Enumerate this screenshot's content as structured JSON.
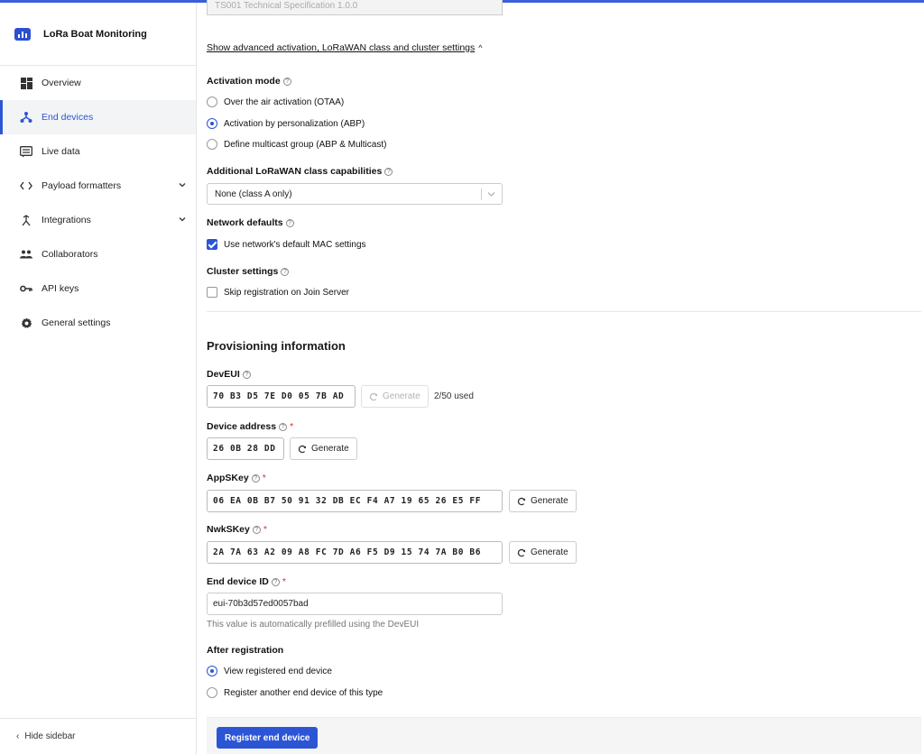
{
  "app": {
    "title": "LoRa Boat Monitoring",
    "accent": "#2c55d6"
  },
  "sidebar": {
    "items": [
      {
        "label": "Overview",
        "icon": "overview-grid-icon"
      },
      {
        "label": "End devices",
        "icon": "devices-icon",
        "active": true
      },
      {
        "label": "Live data",
        "icon": "list-icon"
      },
      {
        "label": "Payload formatters",
        "icon": "code-icon",
        "expandable": true
      },
      {
        "label": "Integrations",
        "icon": "integrations-icon",
        "expandable": true
      },
      {
        "label": "Collaborators",
        "icon": "people-icon"
      },
      {
        "label": "API keys",
        "icon": "key-icon"
      },
      {
        "label": "General settings",
        "icon": "gear-icon"
      }
    ],
    "hide_label": "Hide sidebar"
  },
  "form": {
    "truncated_select_value": "TS001 Technical Specification 1.0.0",
    "advanced_toggle": "Show advanced activation, LoRaWAN class and cluster settings",
    "activation": {
      "label": "Activation mode",
      "options": [
        "Over the air activation (OTAA)",
        "Activation by personalization (ABP)",
        "Define multicast group (ABP & Multicast)"
      ],
      "selected": "Activation by personalization (ABP)"
    },
    "class_caps": {
      "label": "Additional LoRaWAN class capabilities",
      "value": "None (class A only)"
    },
    "network_defaults": {
      "label": "Network defaults",
      "checkbox": "Use network's default MAC settings",
      "checked": true
    },
    "cluster": {
      "label": "Cluster settings",
      "checkbox": "Skip registration on Join Server",
      "checked": false
    },
    "provisioning_title": "Provisioning information",
    "deveui": {
      "label": "DevEUI",
      "value": "70 B3 D5 7E D0 05 7B AD",
      "generate": "Generate",
      "used": "2/50 used"
    },
    "dev_addr": {
      "label": "Device address",
      "value": "26 0B 28 DD",
      "generate": "Generate"
    },
    "appskey": {
      "label": "AppSKey",
      "value": "06 EA 0B B7 50 91 32 DB EC F4 A7 19 65 26 E5 FF",
      "generate": "Generate"
    },
    "nwkskey": {
      "label": "NwkSKey",
      "value": "2A 7A 63 A2 09 A8 FC 7D A6 F5 D9 15 74 7A B0 B6",
      "generate": "Generate"
    },
    "device_id": {
      "label": "End device ID",
      "value": "eui-70b3d57ed0057bad",
      "hint": "This value is automatically prefilled using the DevEUI"
    },
    "after_registration": {
      "label": "After registration",
      "options": [
        "View registered end device",
        "Register another end device of this type"
      ],
      "selected": "View registered end device"
    },
    "submit": "Register end device"
  }
}
